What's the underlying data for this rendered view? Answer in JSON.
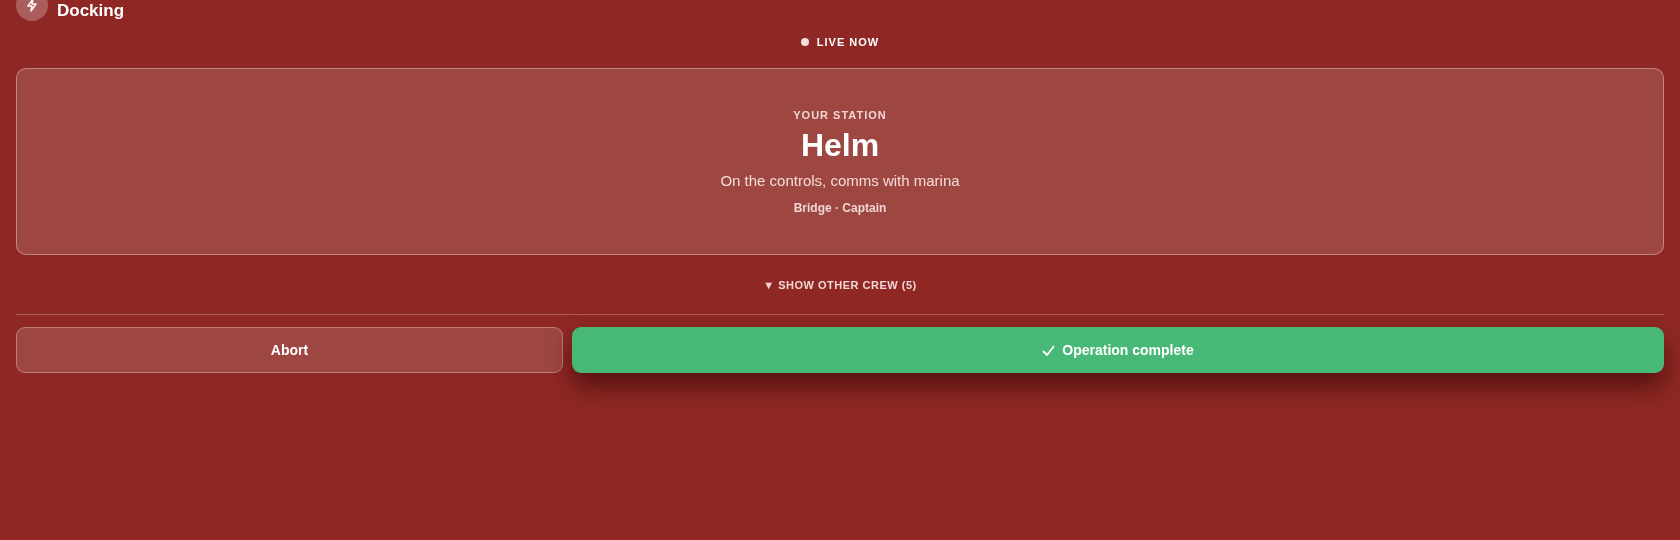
{
  "header": {
    "title": "Docking"
  },
  "live_badge": {
    "label": "LIVE NOW"
  },
  "station_card": {
    "eyebrow": "YOUR STATION",
    "name": "Helm",
    "description": "On the controls, comms with marina",
    "meta": "Bridge · Captain"
  },
  "crew_toggle": {
    "label": "▼ SHOW OTHER CREW (5)"
  },
  "buttons": [
    {
      "label": "Abort",
      "kind": "secondary"
    },
    {
      "label": "Operation complete",
      "kind": "primary"
    }
  ]
}
